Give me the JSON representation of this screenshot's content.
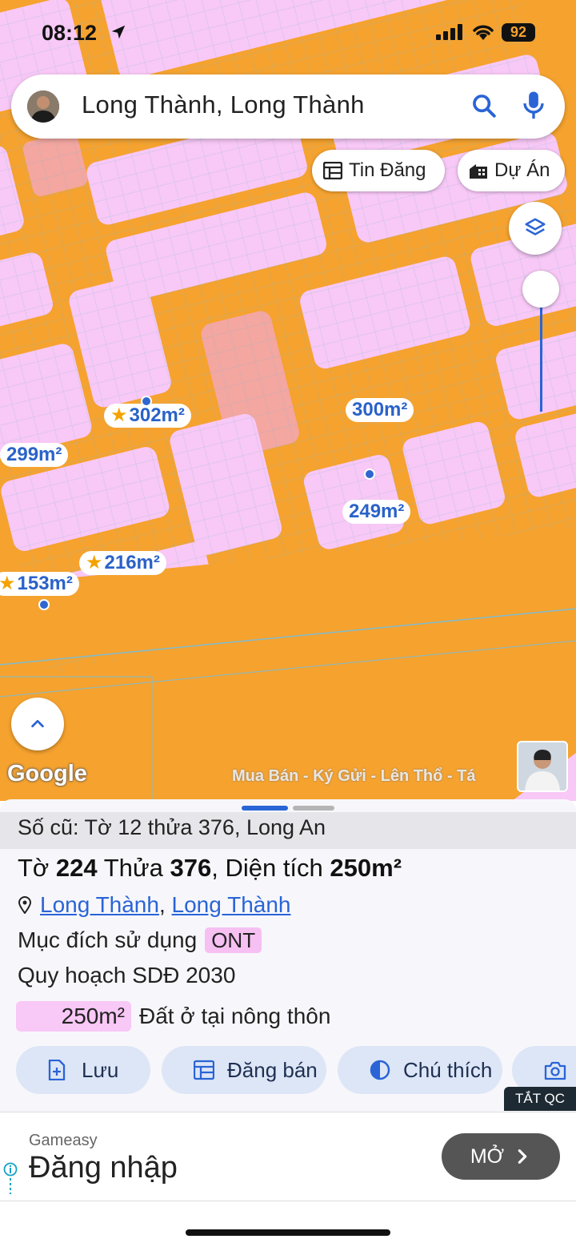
{
  "status_bar": {
    "time": "08:12",
    "battery": "92"
  },
  "search": {
    "query": "Long Thành, Long Thành"
  },
  "chips": {
    "listings": "Tin Đăng",
    "projects": "Dự Án"
  },
  "map": {
    "labels": [
      {
        "area": "302m²",
        "starred": true
      },
      {
        "area": "300m²",
        "starred": false
      },
      {
        "area": "299m²",
        "starred": false
      },
      {
        "area": "249m²",
        "starred": false
      },
      {
        "area": "216m²",
        "starred": true
      },
      {
        "area": "153m²",
        "starred": true
      }
    ],
    "attribution": "Google",
    "watermark": "Mua Bán - Ký Gửi - Lên Thổ - Tá"
  },
  "sheet": {
    "old_number": "Số cũ: Tờ 12 thửa 376, Long An",
    "title_prefix": "Tờ",
    "sheet_no": "224",
    "title_mid": "Thửa",
    "parcel_no": "376",
    "title_area_label": ", Diện tích",
    "area": "250m²",
    "address_1": "Long Thành",
    "address_sep": ",",
    "address_2": "Long Thành",
    "purpose_label": "Mục đích sử dụng",
    "purpose_code": "ONT",
    "plan_label": "Quy hoạch SDĐ 2030",
    "legend_area": "250m²",
    "legend_desc": "Đất ở tại nông thôn",
    "actions": {
      "save": "Lưu",
      "post": "Đăng bán",
      "legend": "Chú thích",
      "capture": "C"
    }
  },
  "ad": {
    "hide_label": "TẮT QC",
    "brand": "Gameasy",
    "title": "Đăng nhập",
    "open_label": "MỞ"
  },
  "colors": {
    "road": "#f5a22f",
    "residential": "#f8c8f6",
    "special": "#f4a6a0",
    "accent": "#2a64d6"
  }
}
